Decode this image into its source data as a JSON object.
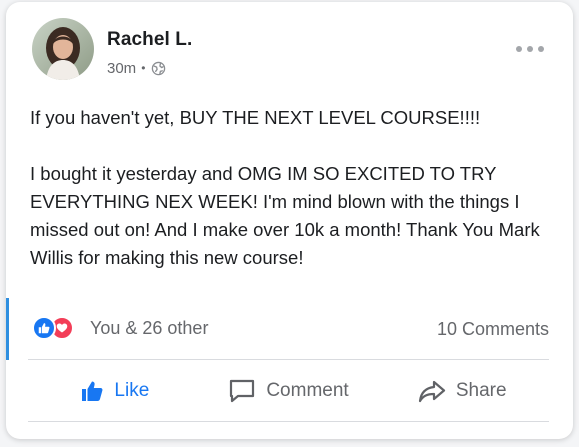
{
  "post": {
    "author": "Rachel L.",
    "time": "30m",
    "separator": "•",
    "privacy_icon": "globe-icon",
    "body": [
      "If you haven't yet, BUY THE NEXT LEVEL COURSE!!!!",
      "I bought it yesterday and OMG IM SO EXCITED TO TRY EVERYTHING NEX WEEK! I'm mind blown with the things I missed out on! And I make over 10k a month! Thank You Mark Willis for making this new course!"
    ]
  },
  "reactions": {
    "icons": [
      "like-reaction-icon",
      "love-reaction-icon"
    ],
    "label": "You & 26 other",
    "comments": "10 Comments"
  },
  "actions": {
    "like": "Like",
    "comment": "Comment",
    "share": "Share"
  },
  "colors": {
    "accent": "#1877f2",
    "love": "#f33e58",
    "muted": "#65676b",
    "text": "#1c1e21",
    "side_bar": "#2f8fe0"
  }
}
